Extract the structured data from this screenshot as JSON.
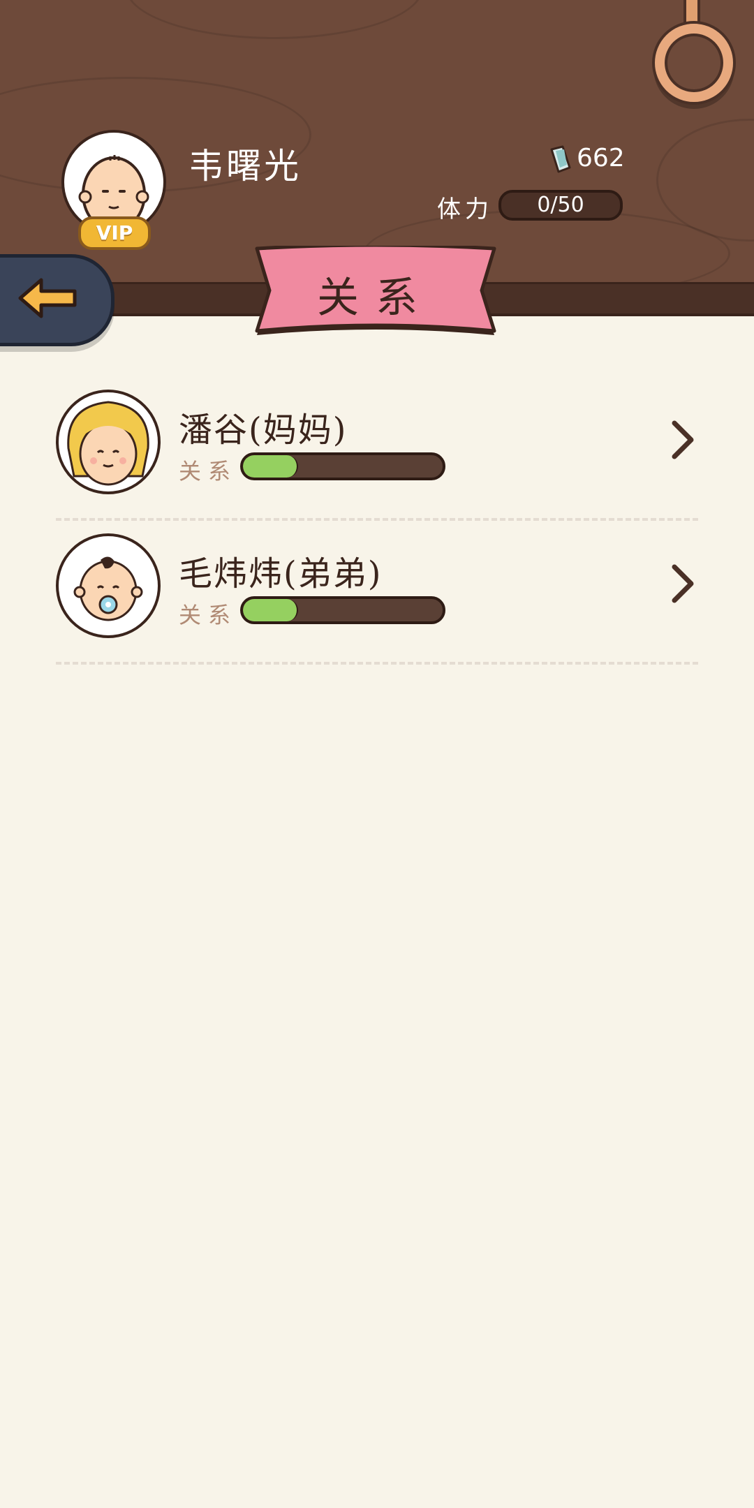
{
  "profile": {
    "name": "韦曙光",
    "vip_label": "VIP",
    "coins": "662",
    "stamina_label": "体力",
    "stamina_value": "0/50"
  },
  "page": {
    "title": "关系",
    "back_icon": "arrow-left-icon"
  },
  "relations": [
    {
      "name": "潘谷(妈妈)",
      "relation_label": "关系",
      "level": 0.27,
      "avatar": "mother-avatar"
    },
    {
      "name": "毛炜炜(弟弟)",
      "relation_label": "关系",
      "level": 0.27,
      "avatar": "baby-brother-avatar"
    }
  ],
  "colors": {
    "wood": "#6e4a3a",
    "ribbon": "#f08aa0",
    "back_button": "#3a4459",
    "progress_fill": "#95d060",
    "background": "#f8f4e9"
  }
}
